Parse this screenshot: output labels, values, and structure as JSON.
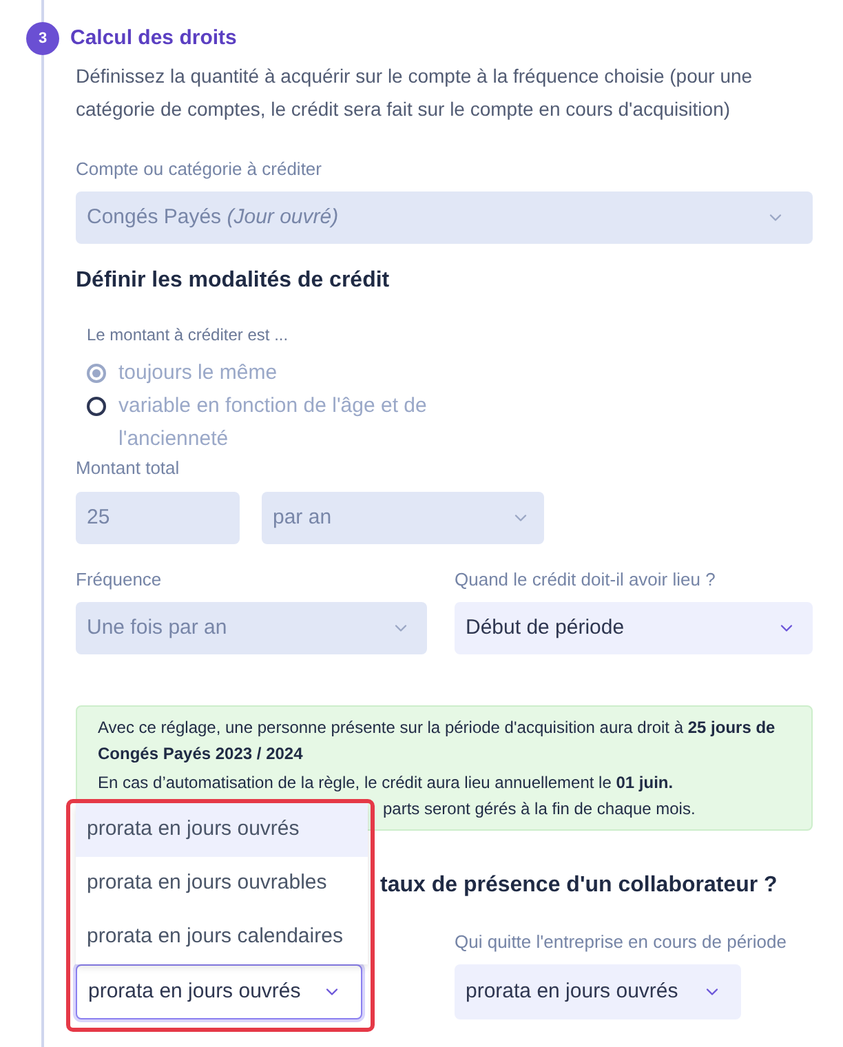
{
  "step": {
    "number": "3",
    "title": "Calcul des droits"
  },
  "description": "Définissez la quantité à acquérir sur le compte à la fréquence choisie (pour une catégorie de comptes, le crédit sera fait sur le compte en cours d'acquisition)",
  "account_field": {
    "label": "Compte ou catégorie à créditer",
    "value": "Congés Payés *(Jour ouvré)*",
    "disabled": true
  },
  "credit_section": {
    "title": "Définir les modalités de crédit",
    "amount_type": {
      "label": "Le montant à créditer est ...",
      "disabled": true,
      "options": [
        {
          "label": "toujours le même",
          "selected": true
        },
        {
          "label": "variable en fonction de l'âge et de l'ancienneté",
          "selected": false
        }
      ]
    },
    "total_amount": {
      "label": "Montant total",
      "value": "25",
      "unit": "par an",
      "disabled": true
    },
    "frequency": {
      "label": "Fréquence",
      "value": "Une fois par an",
      "disabled": true
    },
    "timing": {
      "label": "Quand le crédit doit-il avoir lieu ?",
      "value": "Début de période",
      "disabled": false
    },
    "summary": {
      "paragraphs": [
        "Avec ce réglage, une personne présente sur la période d'acquisition aura droit à **25 jours de Congés Payés 2023 / 2024**",
        "En cas d’automatisation de la règle, le crédit aura lieu annuellement le **01 juin.**",
        "parts seront gérés à la fin de chaque mois."
      ]
    }
  },
  "presence_section": {
    "title": "taux de présence d'un collaborateur ?",
    "fields": [
      {
        "value": "prorata en jours ouvrés",
        "expanded": true,
        "highlighted": true,
        "options": [
          {
            "label": "prorata en jours ouvrés",
            "selected": true
          },
          {
            "label": "prorata en jours ouvrables",
            "selected": false
          },
          {
            "label": "prorata en jours calendaires",
            "selected": false
          }
        ]
      },
      {
        "label": "Qui quitte l'entreprise en cours de période",
        "value": "prorata en jours ouvrés",
        "expanded": false
      }
    ]
  }
}
